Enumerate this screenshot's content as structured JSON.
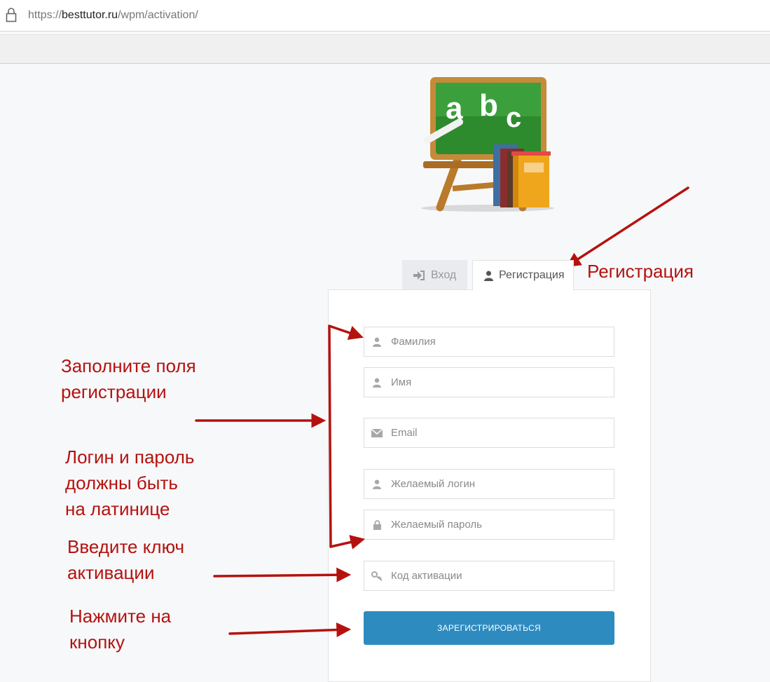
{
  "browser": {
    "url_scheme": "https://",
    "url_host": "besttutor.ru",
    "url_path": "/wpm/activation/"
  },
  "tabs": {
    "login": "Вход",
    "register": "Регистрация"
  },
  "form": {
    "last_name_placeholder": "Фамилия",
    "first_name_placeholder": "Имя",
    "email_placeholder": "Email",
    "login_placeholder": "Желаемый логин",
    "password_placeholder": "Желаемый пароль",
    "activation_placeholder": "Код активации",
    "submit_label": "ЗАРЕГИСТРИРОВАТЬСЯ"
  },
  "annotations": {
    "register_tab": "Регистрация",
    "fill_fields_line1": "Заполните поля",
    "fill_fields_line2": "регистрации",
    "latin_line1": "Логин и пароль",
    "latin_line2": "должны быть",
    "latin_line3": "на латинице",
    "key_line1": "Введите ключ",
    "key_line2": "активации",
    "button_line1": "Нажмите на",
    "button_line2": "кнопку"
  },
  "colors": {
    "annotation": "#b5120f",
    "button": "#2e8bc0"
  }
}
